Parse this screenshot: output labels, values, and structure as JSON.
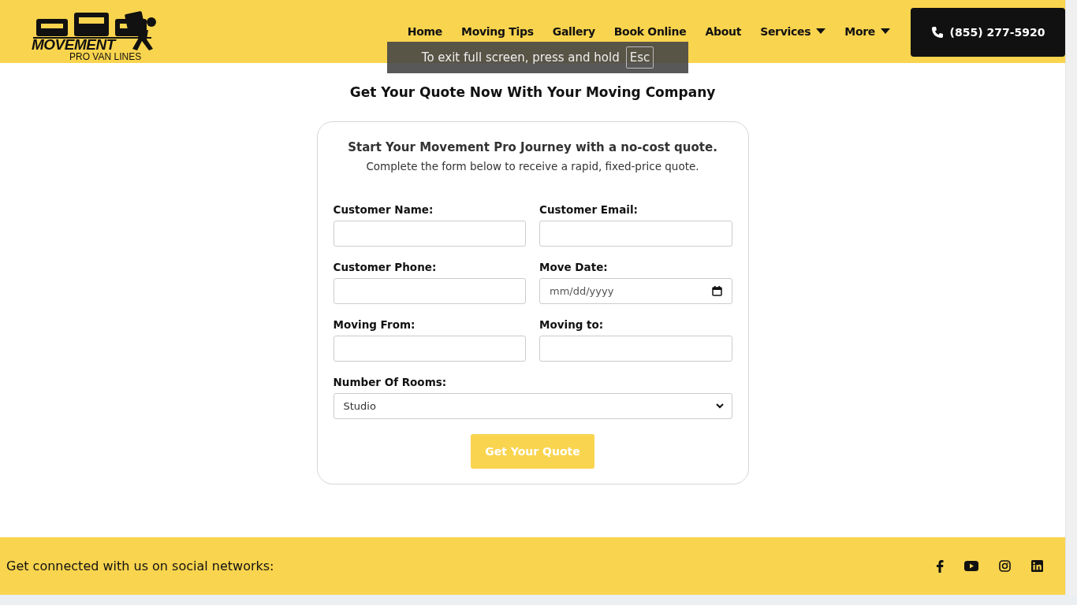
{
  "header": {
    "logo": {
      "title": "MOVEMENT",
      "subtitle": "PRO VAN LINES"
    },
    "nav": [
      {
        "label": "Home",
        "dropdown": false
      },
      {
        "label": "Moving Tips",
        "dropdown": false
      },
      {
        "label": "Gallery",
        "dropdown": false
      },
      {
        "label": "Book Online",
        "dropdown": false
      },
      {
        "label": "About",
        "dropdown": false
      },
      {
        "label": "Services",
        "dropdown": true
      },
      {
        "label": "More",
        "dropdown": true
      }
    ],
    "phone": "(855) 277-5920"
  },
  "fullscreen_notice": {
    "text": "To exit full screen, press and hold",
    "key": "Esc"
  },
  "heading": "Get Your Quote Now With Your Moving Company",
  "form": {
    "title": "Start Your Movement Pro Journey with a no-cost quote.",
    "subtitle": "Complete the form below to receive a rapid, fixed-price quote.",
    "fields": [
      {
        "label": "Customer Name:",
        "kind": "text"
      },
      {
        "label": "Customer Email:",
        "kind": "text"
      },
      {
        "label": "Customer Phone:",
        "kind": "text"
      },
      {
        "label": "Move Date:",
        "kind": "date",
        "placeholder": "mm/dd/yyyy"
      },
      {
        "label": "Moving From:",
        "kind": "text"
      },
      {
        "label": "Moving to:",
        "kind": "text"
      },
      {
        "label": "Number Of Rooms:",
        "kind": "select",
        "value": "Studio"
      }
    ],
    "button": "Get Your Quote"
  },
  "footer": {
    "text": "Get connected with us on social networks:"
  }
}
